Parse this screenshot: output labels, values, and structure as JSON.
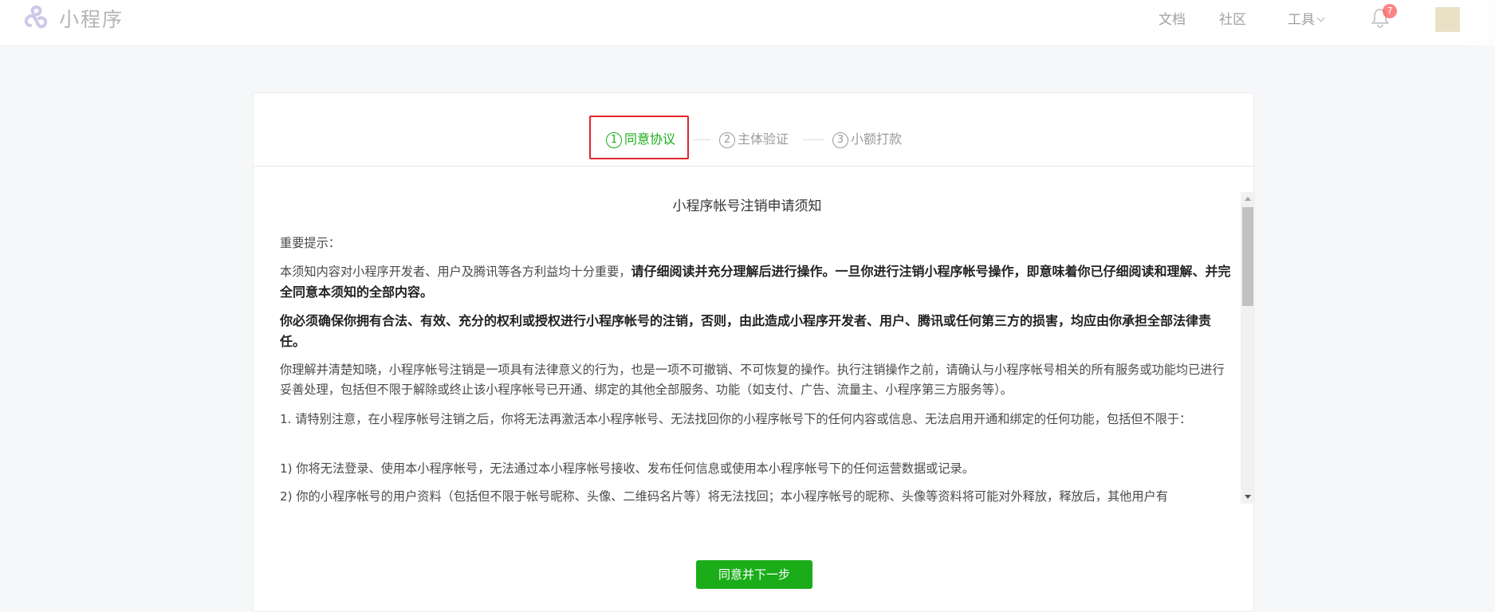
{
  "header": {
    "logo_text": "小程序",
    "nav": {
      "docs": "文档",
      "community": "社区",
      "tools": "工具"
    },
    "notification_count": "7",
    "icons": [
      "miniprogram-logo-icon",
      "chevron-down-icon",
      "bell-icon"
    ]
  },
  "steps": [
    {
      "num": "1",
      "label": "同意协议",
      "state": "active"
    },
    {
      "num": "2",
      "label": "主体验证",
      "state": "pending"
    },
    {
      "num": "3",
      "label": "小额打款",
      "state": "pending"
    }
  ],
  "notice": {
    "title": "小程序帐号注销申请须知",
    "intro_heading": "重要提示：",
    "p1_plain": "本须知内容对小程序开发者、用户及腾讯等各方利益均十分重要，",
    "p1_bold": "请仔细阅读并充分理解后进行操作。一旦你进行注销小程序帐号操作，即意味着你已仔细阅读和理解、并完全同意本须知的全部内容。",
    "p2_bold": "你必须确保你拥有合法、有效、充分的权利或授权进行小程序帐号的注销，否则，由此造成小程序开发者、用户、腾讯或任何第三方的损害，均应由你承担全部法律责任。",
    "p3": "你理解并清楚知晓，小程序帐号注销是一项具有法律意义的行为，也是一项不可撤销、不可恢复的操作。执行注销操作之前，请确认与小程序帐号相关的所有服务或功能均已进行妥善处理，包括但不限于解除或终止该小程序帐号已开通、绑定的其他全部服务、功能（如支付、广告、流量主、小程序第三方服务等）。",
    "p4": "1. 请特别注意，在小程序帐号注销之后，你将无法再激活本小程序帐号、无法找回你的小程序帐号下的任何内容或信息、无法启用开通和绑定的任何功能，包括但不限于：",
    "p5": "1) 你将无法登录、使用本小程序帐号，无法通过本小程序帐号接收、发布任何信息或使用本小程序帐号下的任何运营数据或记录。",
    "p6": "2) 你的小程序帐号的用户资料（包括但不限于帐号昵称、头像、二维码名片等）将无法找回；本小程序帐号的昵称、头像等资料将可能对外释放，释放后，其他用户有"
  },
  "actions": {
    "agree_next": "同意并下一步"
  },
  "colors": {
    "accent": "#1aad19",
    "highlight_border": "#e0262b",
    "badge": "#fa5151"
  }
}
